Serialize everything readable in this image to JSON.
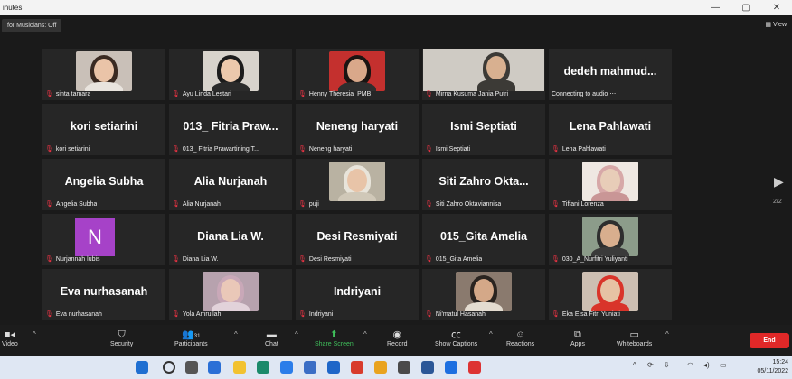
{
  "window": {
    "title": "inutes",
    "controls": [
      "—",
      "▢",
      "✕"
    ]
  },
  "topbar": {
    "music_mode": "for Musicians: Off",
    "view_label": "View"
  },
  "participants": [
    {
      "display": "",
      "label": "sinta tamara",
      "photo": true,
      "hair": "#3a2a22",
      "bg": "#c9c0b8",
      "shirt": "#e9e4de",
      "skin": "#eac4a8"
    },
    {
      "display": "",
      "label": "Ayu Linda Lestari",
      "photo": true,
      "hair": "#1c1c1c",
      "bg": "#d8d3cc",
      "shirt": "#2b2b2b",
      "skin": "#ecc8ac"
    },
    {
      "display": "",
      "label": "Henny Theresia_PMB",
      "photo": true,
      "hair": "#1a1412",
      "bg": "#c4302e",
      "shirt": "#2e2e2e",
      "skin": "#d9a88a"
    },
    {
      "display": "",
      "label": "Mirna Kusuma Jania Putri",
      "photo": true,
      "wide": true,
      "hair": "#3c3a36",
      "bg": "#cfcbc4",
      "shirt": "#3c3a36",
      "skin": "#d8b090"
    },
    {
      "display": "dedeh  mahmud...",
      "label": "Connecting to audio ⋯",
      "photo": false
    },
    {
      "display": "kori setiarini",
      "label": "kori setiarini",
      "photo": false
    },
    {
      "display": "013_ Fitria Praw...",
      "label": "013_ Fitria Prawartining T...",
      "photo": false
    },
    {
      "display": "Neneng haryati",
      "label": "Neneng haryati",
      "photo": false
    },
    {
      "display": "Ismi Septiati",
      "label": "Ismi Septiati",
      "photo": false
    },
    {
      "display": "Lena Pahlawati",
      "label": "Lena Pahlawati",
      "photo": false
    },
    {
      "display": "Angelia Subha",
      "label": "Angelia Subha",
      "photo": false
    },
    {
      "display": "Alia Nurjanah",
      "label": "Alia Nurjanah",
      "photo": false
    },
    {
      "display": "",
      "label": "puji",
      "photo": true,
      "hair": "#e8e4da",
      "bg": "#b9b2a2",
      "shirt": "#d0c8b8",
      "skin": "#e8c4a8"
    },
    {
      "display": "Siti Zahro Okta...",
      "label": "Siti Zahro Oktaviannisa",
      "photo": false
    },
    {
      "display": "",
      "label": "Tiffani Lorenza",
      "photo": true,
      "hair": "#d7a8a8",
      "bg": "#efe8e2",
      "shirt": "#c99696",
      "skin": "#e8cdb8"
    },
    {
      "display": "",
      "label": "Nurjannah lubis",
      "photo": false,
      "initial": "N"
    },
    {
      "display": "Diana Lia W.",
      "label": "Diana Lia W.",
      "photo": false
    },
    {
      "display": "Desi Resmiyati",
      "label": "Desi Resmiyati",
      "photo": false
    },
    {
      "display": "015_Gita Amelia",
      "label": "015_Gita Amelia",
      "photo": false
    },
    {
      "display": "",
      "label": "030_A_Nurfitri Yuliyanti",
      "photo": true,
      "hair": "#2e2e2e",
      "bg": "#8c9c8a",
      "shirt": "#3a3a3a",
      "skin": "#d8ae8e"
    },
    {
      "display": "Eva nurhasanah",
      "label": "Eva nurhasanah",
      "photo": false
    },
    {
      "display": "",
      "label": "Yola Amrullah",
      "photo": true,
      "hair": "#c9a8b8",
      "bg": "#b7a2ae",
      "shirt": "#e2d2da",
      "skin": "#eac8b8"
    },
    {
      "display": "Indriyani",
      "label": "Indriyani",
      "photo": false
    },
    {
      "display": "",
      "label": "Ni'matul Hasanah",
      "photo": true,
      "hair": "#2a2420",
      "bg": "#8a7a6e",
      "shirt": "#e4dcd0",
      "skin": "#d4a888"
    },
    {
      "display": "",
      "label": "Eka Elsa Fitri Yuniati",
      "photo": true,
      "hair": "#d9342a",
      "bg": "#cdbfb2",
      "shirt": "#d9342a",
      "skin": "#e6c2a4"
    }
  ],
  "pager": {
    "indicator": "2/2"
  },
  "toolbar": {
    "video": "Video",
    "security": "Security",
    "participants": "Participants",
    "participants_count": "31",
    "chat": "Chat",
    "share_screen": "Share Screen",
    "record": "Record",
    "show_captions": "Show Captions",
    "reactions": "Reactions",
    "apps": "Apps",
    "whiteboards": "Whiteboards",
    "end": "End"
  },
  "taskbar": {
    "time": "15:24",
    "date": "05/11/2022"
  },
  "colors": {
    "accent_green": "#3fbf5b",
    "end_red": "#e02828",
    "initial_purple": "#a642c8"
  }
}
